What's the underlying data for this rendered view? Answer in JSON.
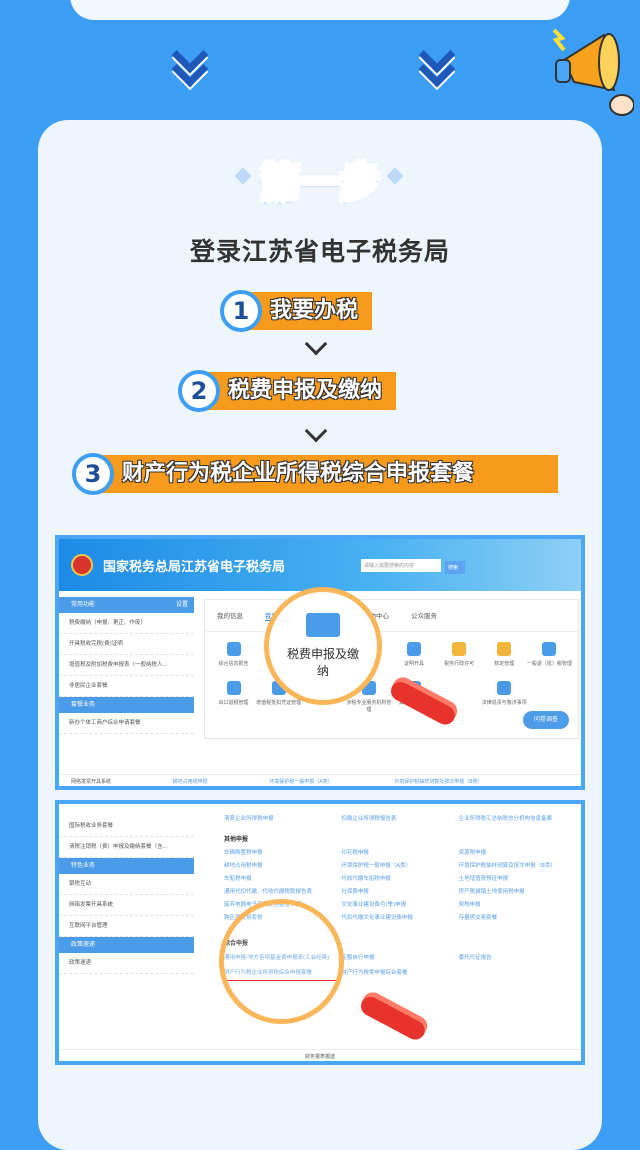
{
  "colors": {
    "background": "#3d9ef6",
    "accent": "#f89a1c",
    "card": "#eef5fd",
    "link": "#5a9ee8"
  },
  "step_title": "第一步",
  "heading": "登录江苏省电子税务局",
  "steps": [
    {
      "num": "1",
      "label": "我要办税"
    },
    {
      "num": "2",
      "label": "税费申报及缴纳"
    },
    {
      "num": "3",
      "label": "财产行为税企业所得税综合申报套餐"
    }
  ],
  "shot1": {
    "site_title": "国家税务总局江苏省电子税务局",
    "search_placeholder": "请输入需要搜索的内容",
    "search_btn": "搜索",
    "side_header1": "常用功能",
    "side_header1_action": "设置",
    "side_items1": [
      "税费缴纳（申报、更正、作废）",
      "开具税收完税(费)证明",
      "增值税及附加税费申报表（一般纳税人...",
      "非居民企业套餐"
    ],
    "side_header2": "套餐业务",
    "side_items2": [
      "新办个体工商户综合申请套餐"
    ],
    "tabs": [
      "我的信息",
      "我要办税",
      "互动中心",
      "公众服务"
    ],
    "grid": [
      "综合信息报告",
      "",
      "",
      "证明开具",
      "税务行政许可",
      "核定管理",
      "一般退（抵）税管理",
      "出口退税管理",
      "增值税抵扣凭证管理",
      "",
      "涉税专业服务机构管理",
      "其他服务事项",
      "",
      "法律追责与救济事项",
      ""
    ],
    "magnified": "税费申报及缴纳",
    "survey": "问卷调查",
    "footer_items": [
      "网络发票开具系统",
      "耕地占用税申报",
      "环境保护税一般申报（A类）",
      "环境保护税抽样测算及按次申报（B类）"
    ]
  },
  "shot2": {
    "side_items_top": [
      "国际税收业务套餐",
      "清税注销税（费）申报及缴纳套餐（含..."
    ],
    "side_header3": "特色业务",
    "side_items3": [
      "银税互动",
      "网络发票开具系统",
      "互联网平台管理"
    ],
    "side_header4": "政策速递",
    "side_items4": [
      "政策速递"
    ],
    "top_links": [
      "清算企业所得税申报",
      "扣缴企业所得税报告表",
      "企业所得税汇总纳税总分机构信息备案"
    ],
    "other_title": "其他申报",
    "other_links": [
      "车辆购置税申报",
      "印花税申报",
      "资源税申报",
      "耕地占用税申报",
      "环境保护税一般申报（A类）",
      "环境保护税抽样测算及按次申报（B类）",
      "车船税申报",
      "代收代缴车船税申报",
      "土地增值税预征申报",
      "通用代扣代缴、代收代缴税款报告表",
      "社保费申报",
      "房产税城镇土地使用税申报",
      "废弃电器电子产品处理基金申报",
      "文化事业建设费月(季)申报",
      "契税申报",
      "跨区房交易套餐",
      "代扣代缴文化事业建设费申报",
      "存量房交易套餐"
    ],
    "combined_title": "综合申报",
    "combined_links": [
      "通用申报-地方各项基金费申报表(工会经费)",
      "定额自行申报",
      "委托代征报告",
      "财产行为税企业所得税综合申报套餐",
      "财产行为税零申报综合套餐"
    ],
    "footer": "财务报表报送"
  }
}
